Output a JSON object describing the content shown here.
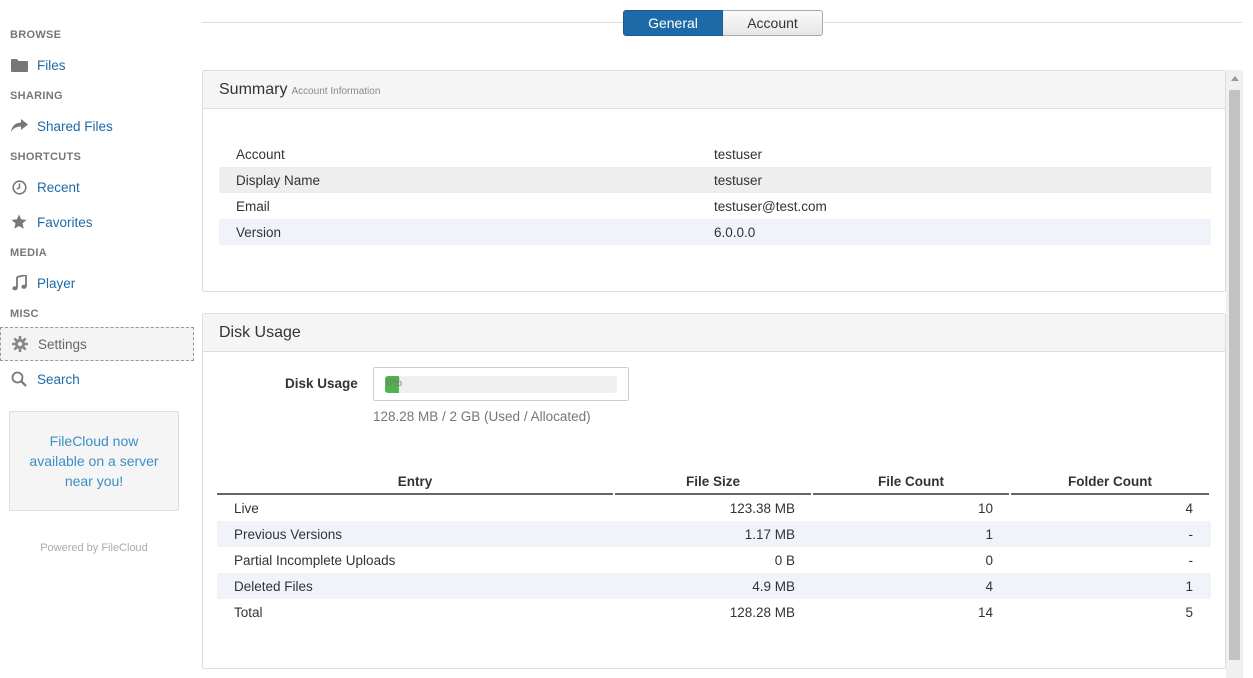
{
  "sidebar": {
    "sections": {
      "browse": "BROWSE",
      "sharing": "SHARING",
      "shortcuts": "SHORTCUTS",
      "media": "MEDIA",
      "misc": "MISC"
    },
    "items": {
      "files": {
        "label": "Files",
        "icon": "folder-icon"
      },
      "shared": {
        "label": "Shared Files",
        "icon": "share-icon"
      },
      "recent": {
        "label": "Recent",
        "icon": "clock-icon"
      },
      "favorites": {
        "label": "Favorites",
        "icon": "star-icon"
      },
      "player": {
        "label": "Player",
        "icon": "music-icon"
      },
      "settings": {
        "label": "Settings",
        "icon": "gear-icon"
      },
      "search": {
        "label": "Search",
        "icon": "search-icon"
      }
    },
    "promo": "FileCloud now available on a server near you!",
    "powered": "Powered by FileCloud"
  },
  "tabs": {
    "general": "General",
    "account": "Account"
  },
  "summary": {
    "title": "Summary",
    "subtitle": "Account Information",
    "rows": [
      {
        "key": "Account",
        "value": "testuser"
      },
      {
        "key": "Display Name",
        "value": "testuser"
      },
      {
        "key": "Email",
        "value": "testuser@test.com"
      },
      {
        "key": "Version",
        "value": "6.0.0.0"
      }
    ]
  },
  "disk": {
    "title": "Disk Usage",
    "label": "Disk Usage",
    "percent_text": "6%",
    "percent": 6,
    "usage_text": "128.28 MB / 2 GB (Used / Allocated)",
    "headers": {
      "entry": "Entry",
      "size": "File Size",
      "count": "File Count",
      "folders": "Folder Count"
    },
    "rows": [
      {
        "entry": "Live",
        "size": "123.38 MB",
        "count": "10",
        "folders": "4"
      },
      {
        "entry": "Previous Versions",
        "size": "1.17 MB",
        "count": "1",
        "folders": "-"
      },
      {
        "entry": "Partial Incomplete Uploads",
        "size": "0 B",
        "count": "0",
        "folders": "-"
      },
      {
        "entry": "Deleted Files",
        "size": "4.9 MB",
        "count": "4",
        "folders": "1"
      },
      {
        "entry": "Total",
        "size": "128.28 MB",
        "count": "14",
        "folders": "5"
      }
    ]
  },
  "colors": {
    "accent": "#1e6aa8",
    "link": "#1e6aa8",
    "progress": "#4fb34f"
  }
}
